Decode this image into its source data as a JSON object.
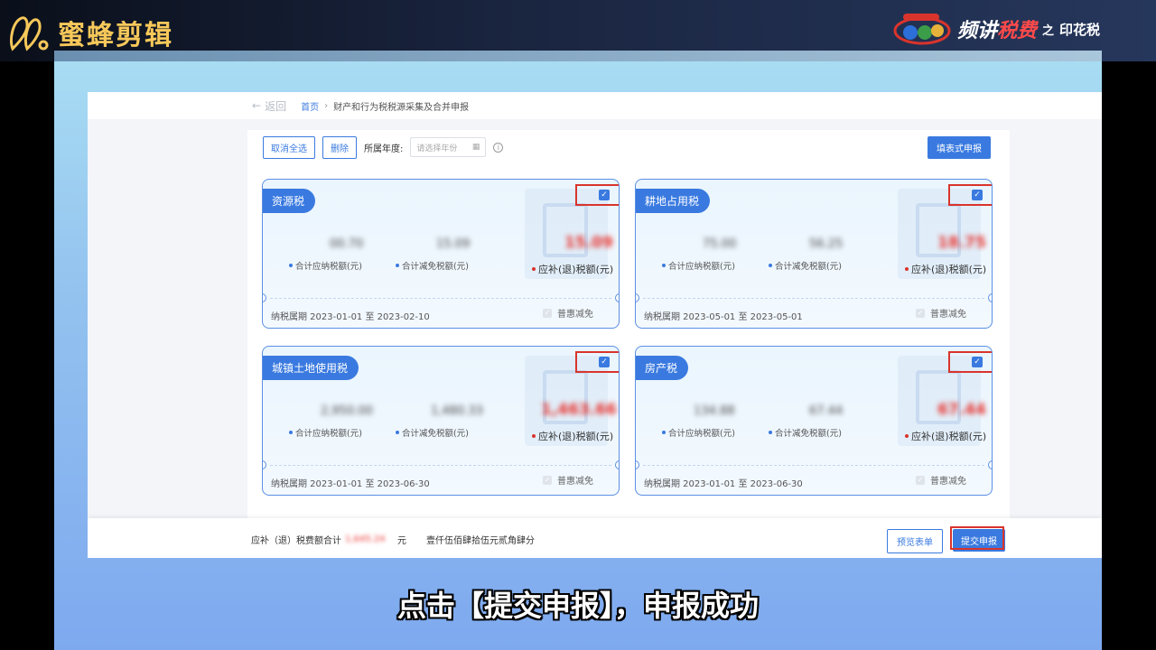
{
  "brand": {
    "name": "蜜蜂剪辑"
  },
  "series": {
    "title_a": "频讲",
    "title_b": "税费",
    "zhi": "之",
    "topic": "印花税"
  },
  "breadcrumb": {
    "back": "返回",
    "home": "首页",
    "current": "财产和行为税税源采集及合并申报"
  },
  "toolbar": {
    "cancel_all": "取消全选",
    "delete": "删除",
    "year_label": "所属年度:",
    "year_placeholder": "请选择年份",
    "fill_form": "填表式申报"
  },
  "cards": [
    {
      "tag": "资源税",
      "n1": "00.70",
      "n2": "15.09",
      "n3": "15.09",
      "m1": "合计应纳税额(元)",
      "m2": "合计减免税额(元)",
      "m3": "应补(退)税额(元)",
      "period": "纳税属期 2023-01-01 至 2023-02-10",
      "relief": "普惠减免"
    },
    {
      "tag": "耕地占用税",
      "n1": "75.00",
      "n2": "56.25",
      "n3": "18.75",
      "m1": "合计应纳税额(元)",
      "m2": "合计减免税额(元)",
      "m3": "应补(退)税额(元)",
      "period": "纳税属期 2023-05-01 至 2023-05-01",
      "relief": "普惠减免"
    },
    {
      "tag": "城镇土地使用税",
      "n1": "2,950.00",
      "n2": "1,480.33",
      "n3": "1,463.66",
      "m1": "合计应纳税额(元)",
      "m2": "合计减免税额(元)",
      "m3": "应补(退)税额(元)",
      "period": "纳税属期 2023-01-01 至 2023-06-30",
      "relief": "普惠减免"
    },
    {
      "tag": "房产税",
      "n1": "134.88",
      "n2": "67.44",
      "n3": "67.44",
      "m1": "合计应纳税额(元)",
      "m2": "合计减免税额(元)",
      "m3": "应补(退)税额(元)",
      "period": "纳税属期 2023-01-01 至 2023-06-30",
      "relief": "普惠减免"
    }
  ],
  "footer": {
    "total_label": "应补（退）税费额合计",
    "total_value": "1,645.24",
    "unit": "元",
    "total_words": "壹仟伍佰肆拾伍元贰角肆分",
    "preview": "预览表单",
    "submit": "提交申报"
  },
  "subtitle": "点击【提交申报】，申报成功",
  "colors": {
    "primary": "#3a7ae0",
    "highlight": "#d9342c",
    "brand": "#f7c85a"
  }
}
